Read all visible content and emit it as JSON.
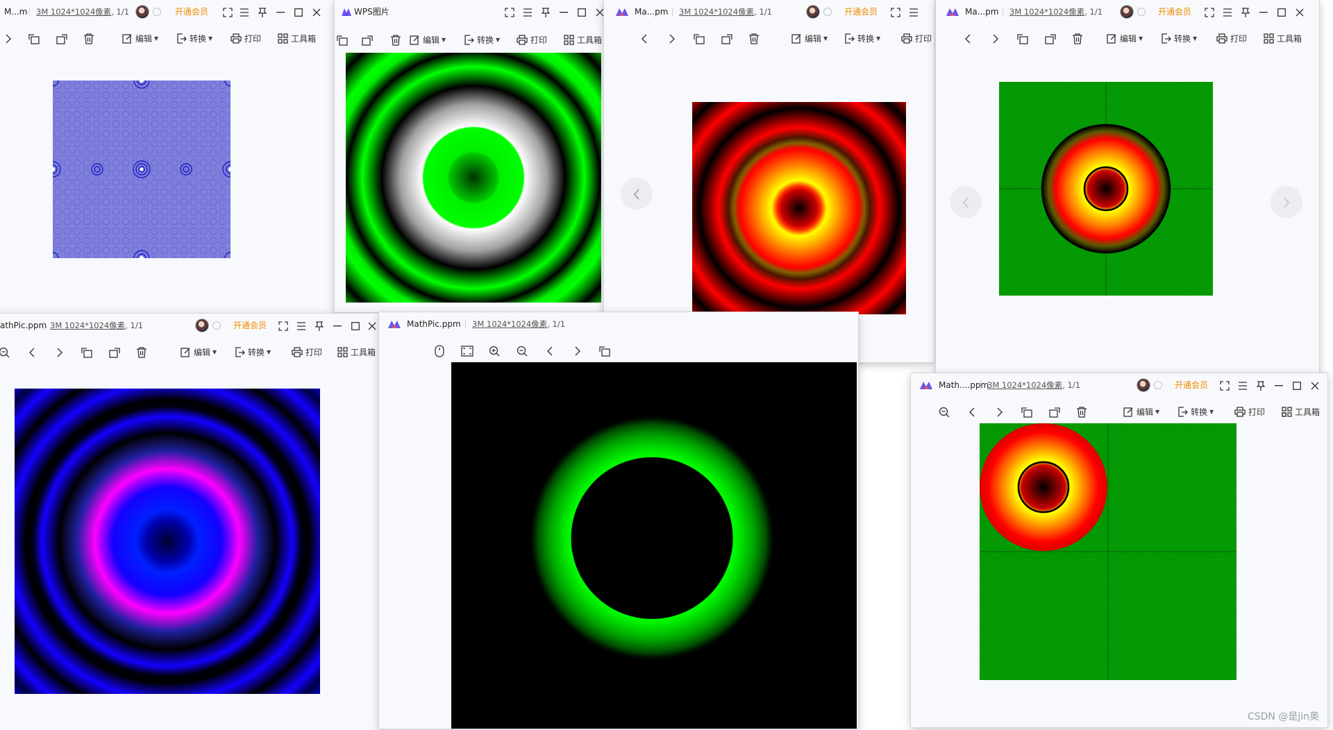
{
  "windows": [
    {
      "title": "M...m",
      "info": "3M 1024*1024像素",
      "pages": "1/1",
      "vip": "开通会员",
      "picture": "purple-moire-pattern"
    },
    {
      "title": "WPS图片",
      "picture": "green-white-rings",
      "tools": {
        "edit": "编辑",
        "convert": "转换",
        "print": "打印",
        "toolbox": "工具箱"
      }
    },
    {
      "title": "Ma...pm",
      "info": "3M 1024*1024像素",
      "pages": "1/1",
      "vip": "开通会员",
      "picture": "red-yellow-rings",
      "tools": {
        "edit": "编辑",
        "convert": "转换",
        "print": "打印"
      }
    },
    {
      "title": "Ma...pm",
      "info": "3M 1024*1024像素",
      "pages": "1/1",
      "vip": "开通会员",
      "picture": "orange-disc-on-green-noise",
      "tools": {
        "edit": "编辑",
        "convert": "转换",
        "print": "打印",
        "toolbox": "工具箱"
      }
    },
    {
      "title": "athPic.ppm",
      "info": "3M 1024*1024像素",
      "pages": "1/1",
      "vip": "开通会员",
      "picture": "blue-magenta-rings",
      "tools": {
        "edit": "编辑",
        "convert": "转换",
        "print": "打印",
        "toolbox": "工具箱"
      }
    },
    {
      "title": "MathPic.ppm",
      "info": "3M 1024*1024像素",
      "pages": "1/1",
      "picture": "green-glow-ring-on-black"
    },
    {
      "title": "Math....ppm",
      "info": "3M 1024*1024像素",
      "pages": "1/1",
      "vip": "开通会员",
      "picture": "corner-disc-on-green-noise",
      "tools": {
        "edit": "编辑",
        "convert": "转换",
        "print": "打印",
        "toolbox": "工具箱"
      }
    }
  ],
  "tool_labels": {
    "edit": "编辑",
    "convert": "转换",
    "print": "打印",
    "toolbox": "工具箱"
  },
  "watermark": "CSDN @是jin奥",
  "colors": {
    "vip": "#f08c00",
    "green": "#00ee00",
    "red": "#ff0000",
    "blue": "#1400ff",
    "magenta": "#ff00ff"
  }
}
